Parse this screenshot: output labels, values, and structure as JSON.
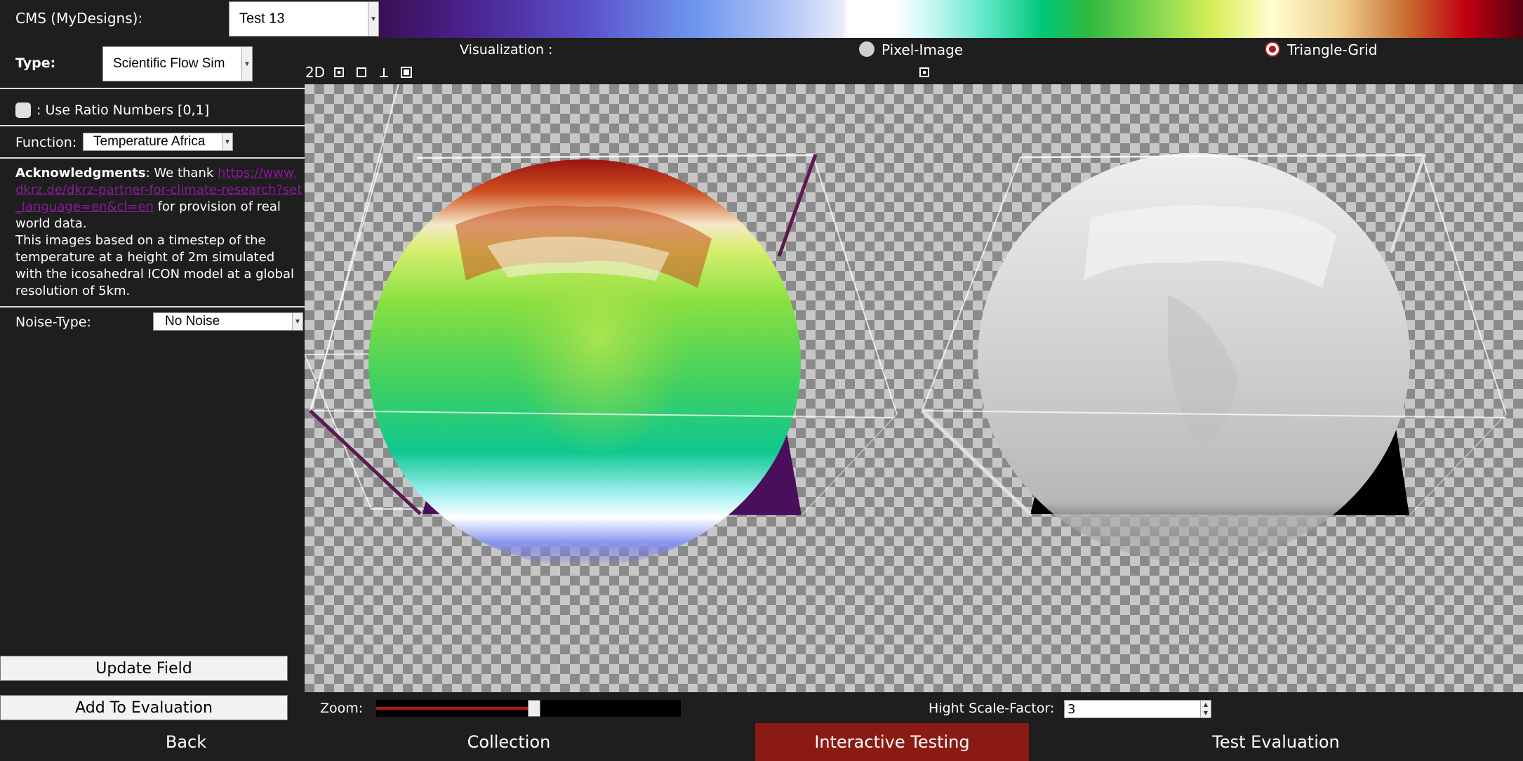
{
  "cms": {
    "label": "CMS (MyDesigns):",
    "selected": "Test 13"
  },
  "colormap": {
    "stops": [
      "#3b0f54",
      "#6f98f0",
      "#ffffff",
      "#00c878",
      "#d8ef58",
      "#fffdcf",
      "#c00010",
      "#5a0010"
    ]
  },
  "type": {
    "label": "Type:",
    "selected": "Scientific Flow Sim"
  },
  "ratio": {
    "label": ": Use Ratio Numbers [0,1]",
    "checked": false
  },
  "function": {
    "label": "Function:",
    "selected": "Temperature Africa"
  },
  "acknowledgments": {
    "heading": "Acknowledgments",
    "prefix": ": We thank ",
    "link": "https://www.dkrz.de/dkrz-partner-for-climate-research?set_language=en&cl=en",
    "suffix": " for provision of real world data.",
    "description": "This images based on a timestep of the temperature at a height of 2m simulated with the icosahedral ICON model at a global resolution of 5km."
  },
  "noise": {
    "label": "Noise-Type:",
    "selected": "No Noise"
  },
  "buttons": {
    "update": "Update Field",
    "add": "Add To Evaluation"
  },
  "visualization": {
    "label": "Visualization :",
    "options": [
      {
        "label": "Pixel-Image",
        "selected": false
      },
      {
        "label": "Triangle-Grid",
        "selected": true
      }
    ]
  },
  "toolbar": {
    "mode_2d": "2D",
    "tools": [
      "dot-square-icon",
      "square-icon",
      "axis-icon",
      "filled-square-icon"
    ],
    "right_tool": "dot-square-icon"
  },
  "zoom": {
    "label": "Zoom:",
    "value": 0.52
  },
  "height_scale": {
    "label": "Hight Scale-Factor:",
    "value": "3"
  },
  "nav": [
    {
      "label": "Back",
      "active": false
    },
    {
      "label": "Collection",
      "active": false
    },
    {
      "label": "Interactive Testing",
      "active": true
    },
    {
      "label": "Test Evaluation",
      "active": false
    }
  ],
  "colors": {
    "active_tab": "#8b1a12",
    "accent": "#b01818",
    "link": "#8a1a9a",
    "base_purple": "#4a0f5a"
  }
}
